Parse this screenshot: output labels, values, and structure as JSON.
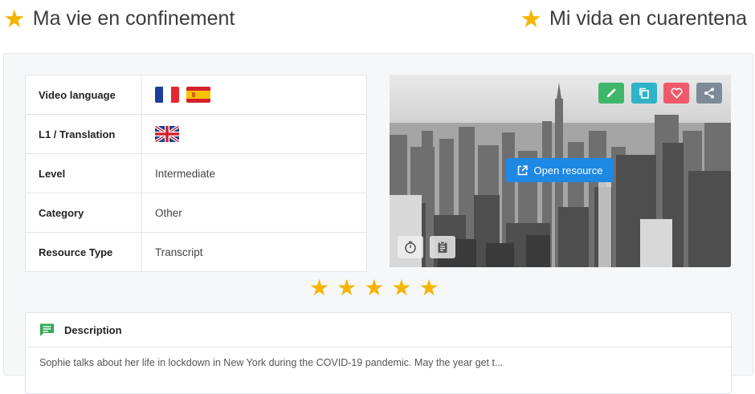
{
  "titles": {
    "left": "Ma vie en confinement",
    "right": "Mi vida en cuarentena",
    "star_icon": "star-icon"
  },
  "info": {
    "rows": [
      {
        "label": "Video language",
        "value": "",
        "flags": [
          "france",
          "spain"
        ]
      },
      {
        "label": "L1 / Translation",
        "value": "",
        "flags": [
          "united-kingdom"
        ]
      },
      {
        "label": "Level",
        "value": "Intermediate"
      },
      {
        "label": "Category",
        "value": "Other"
      },
      {
        "label": "Resource Type",
        "value": "Transcript"
      }
    ]
  },
  "media": {
    "open_label": "Open resource",
    "actions": [
      {
        "icon": "edit-icon",
        "color": "#3fb76a"
      },
      {
        "icon": "copy-icon",
        "color": "#2eb3c9"
      },
      {
        "icon": "heart-icon",
        "color": "#ef5a6a"
      },
      {
        "icon": "share-icon",
        "color": "#7d8a97"
      }
    ],
    "tools": [
      {
        "icon": "timer-icon"
      },
      {
        "icon": "clipboard-icon"
      }
    ]
  },
  "rating": {
    "stars": 5,
    "max": 5,
    "color": "#f5b400"
  },
  "description": {
    "heading": "Description",
    "icon": "comment-icon",
    "body": "Sophie talks about her life in lockdown in New York during the COVID-19 pandemic. May the year get t..."
  }
}
